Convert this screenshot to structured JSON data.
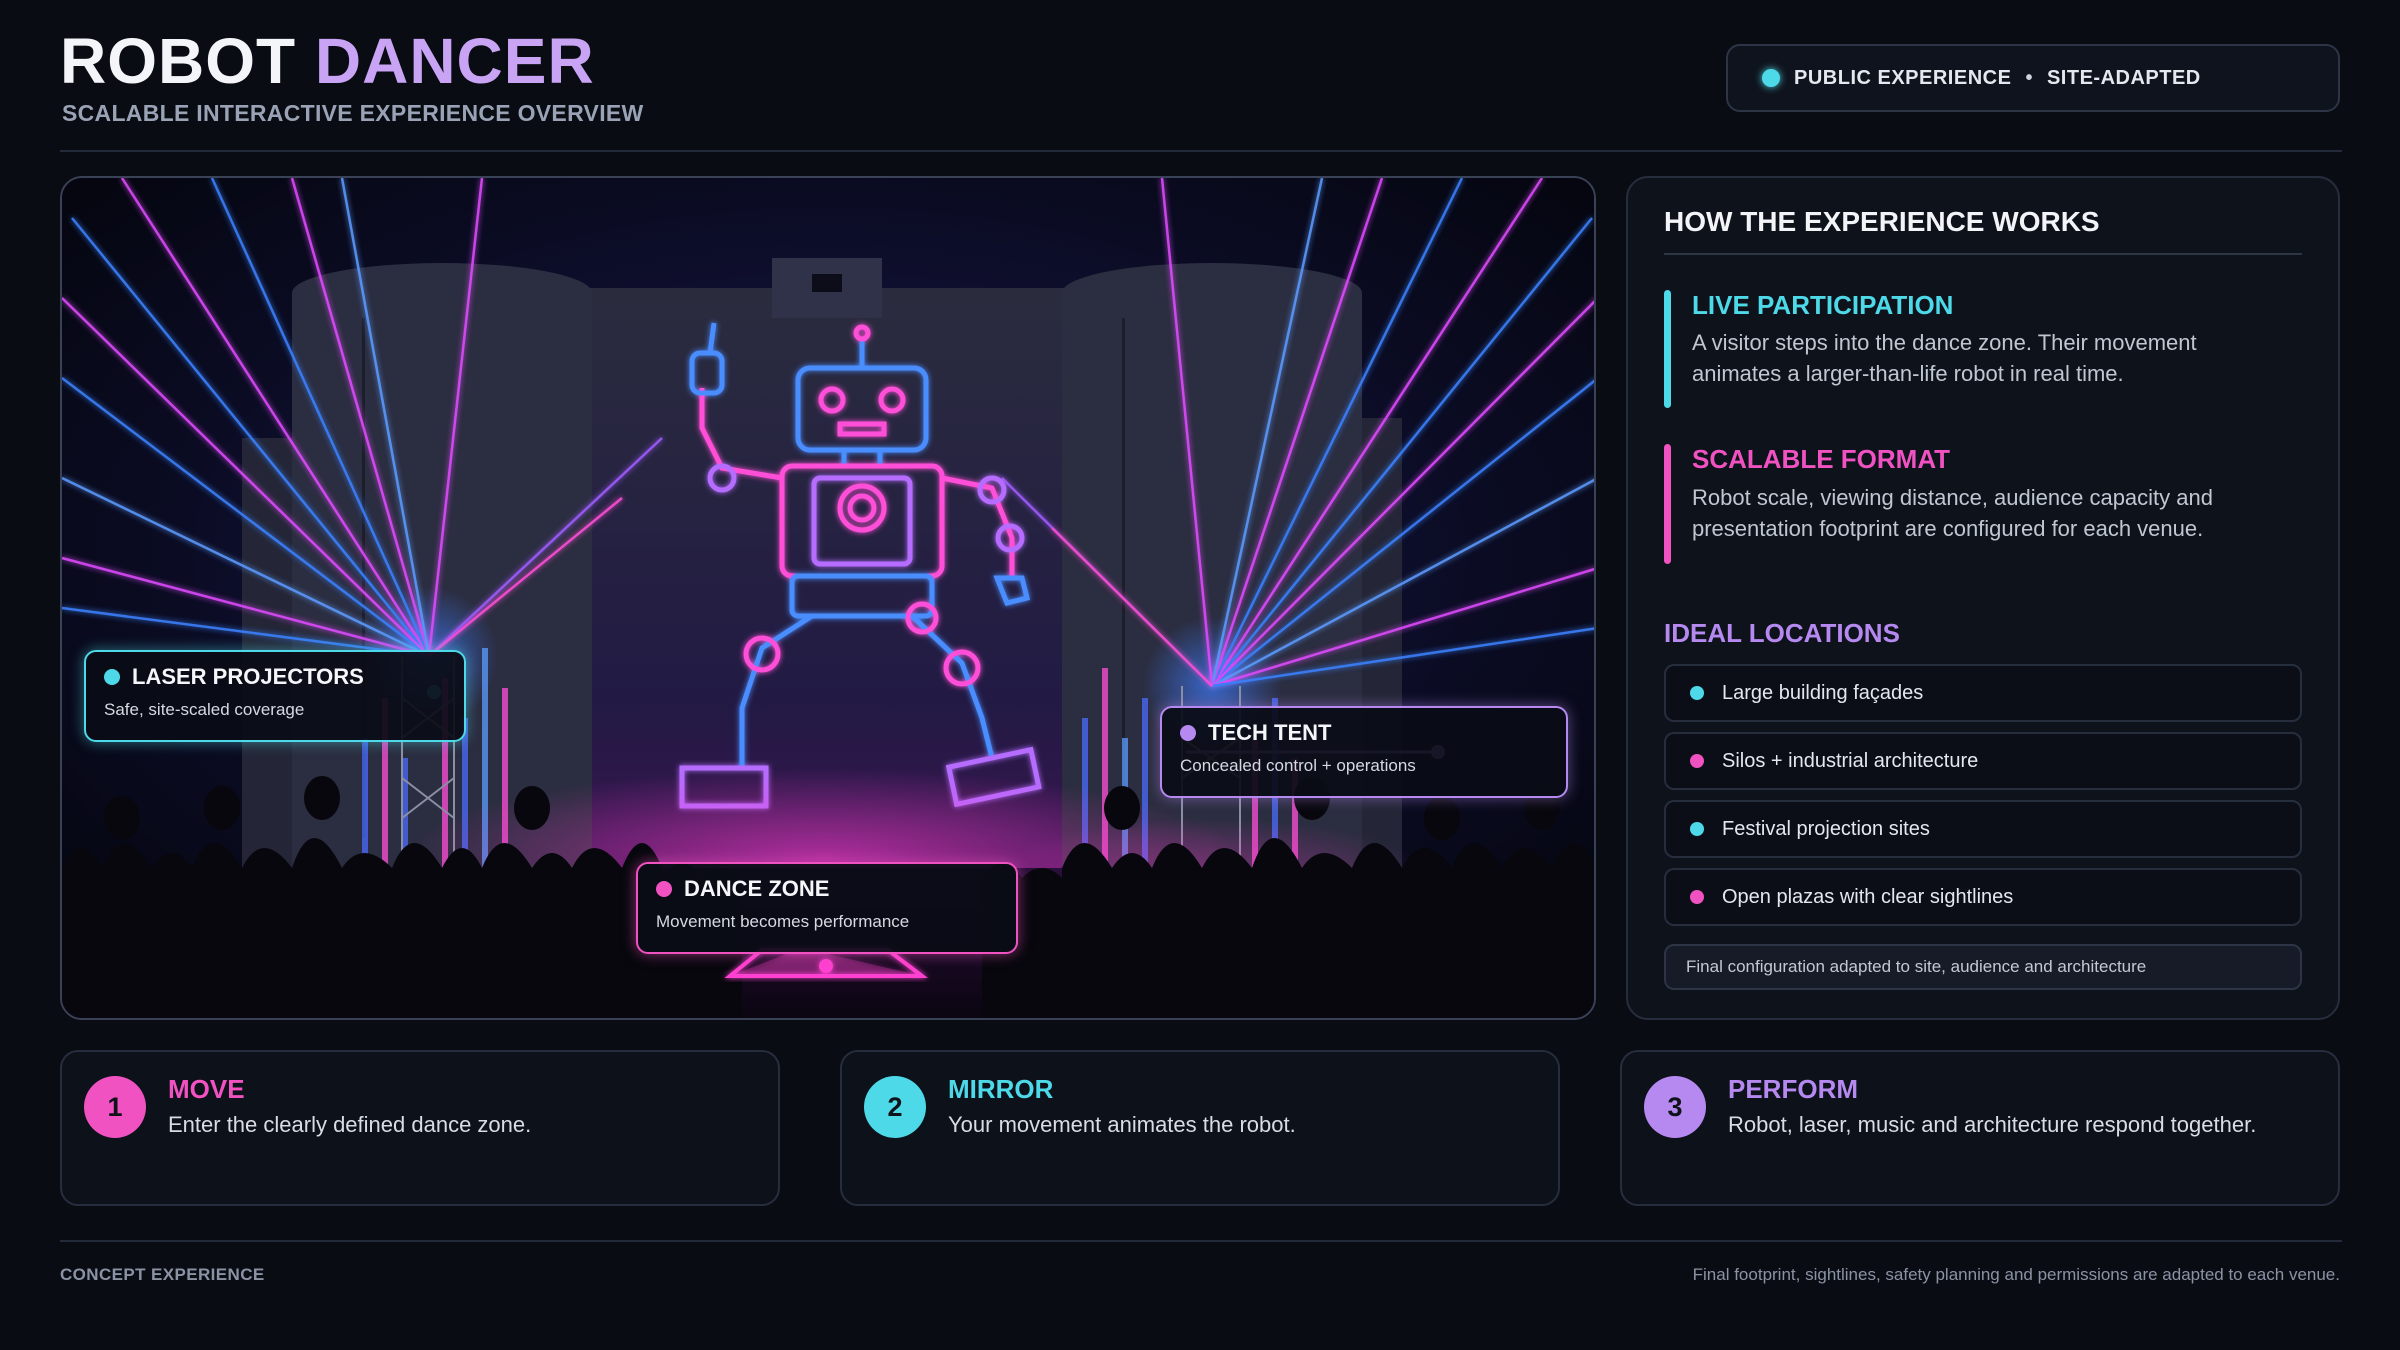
{
  "header": {
    "title_part1": "ROBOT",
    "title_part2": "DANCER",
    "subtitle": "SCALABLE INTERACTIVE EXPERIENCE OVERVIEW",
    "status_left": "PUBLIC EXPERIENCE",
    "status_separator": "•",
    "status_right": "SITE-ADAPTED"
  },
  "hero": {
    "callouts": {
      "laser": {
        "title": "LASER PROJECTORS",
        "desc": "Safe, site-scaled coverage"
      },
      "dance": {
        "title": "DANCE ZONE",
        "desc": "Movement becomes performance"
      },
      "tech": {
        "title": "TECH TENT",
        "desc": "Concealed control + operations"
      }
    }
  },
  "panel": {
    "title": "HOW THE EXPERIENCE WORKS",
    "features": [
      {
        "title": "LIVE PARTICIPATION",
        "desc": "A visitor steps into the dance zone. Their movement animates a larger-than-life robot in real time."
      },
      {
        "title": "SCALABLE FORMAT",
        "desc": "Robot scale, viewing distance, audience capacity and presentation footprint are configured for each venue."
      }
    ],
    "locations_title": "IDEAL LOCATIONS",
    "locations": [
      "Large building façades",
      "Silos + industrial architecture",
      "Festival projection sites",
      "Open plazas with clear sightlines"
    ],
    "note": "Final configuration adapted to site, audience and architecture"
  },
  "steps": [
    {
      "num": "1",
      "title": "MOVE",
      "desc": "Enter the clearly defined dance zone."
    },
    {
      "num": "2",
      "title": "MIRROR",
      "desc": "Your movement animates the robot."
    },
    {
      "num": "3",
      "title": "PERFORM",
      "desc": "Robot, laser, music and architecture respond together."
    }
  ],
  "footer": {
    "left": "CONCEPT EXPERIENCE",
    "right": "Final footprint, sightlines, safety planning and permissions are adapted to each venue."
  },
  "colors": {
    "cyan": "#4dd9e8",
    "magenta": "#f052c1",
    "purple": "#b589f0",
    "background": "#0a0c14"
  }
}
